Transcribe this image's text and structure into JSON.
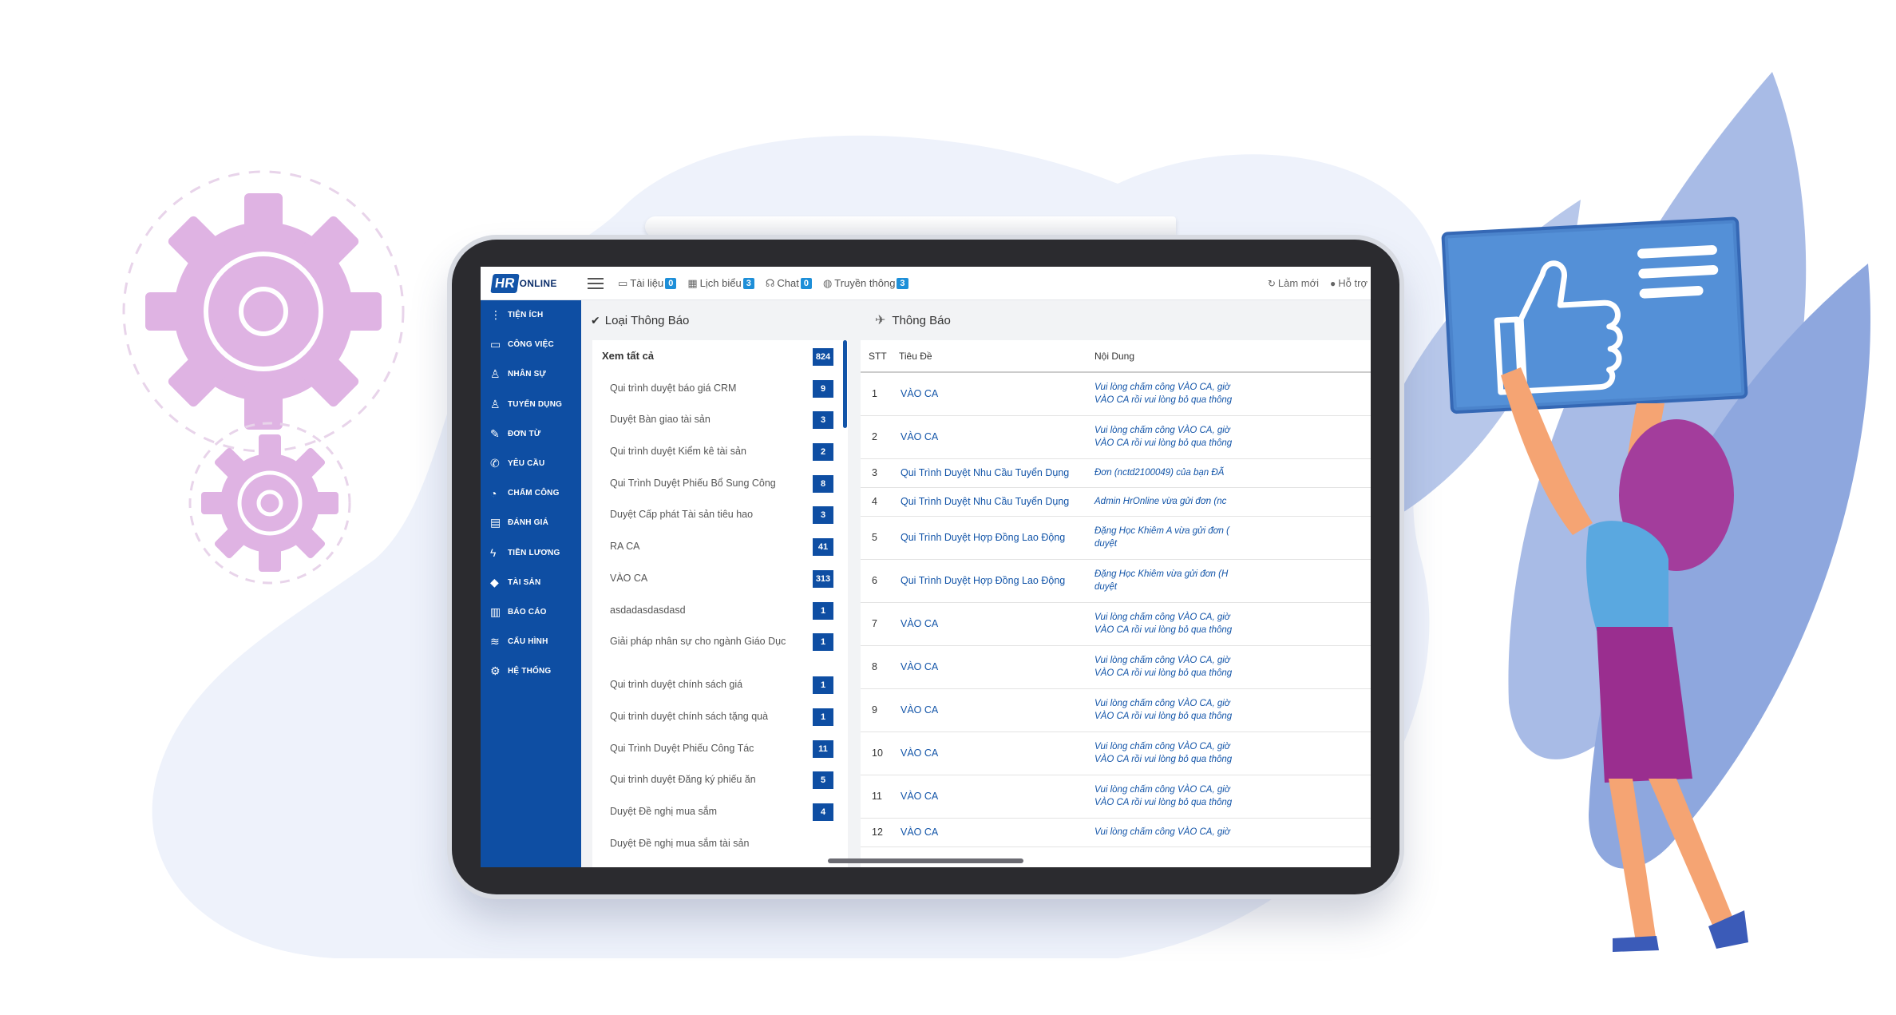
{
  "colors": {
    "sidebar": "#0e4ea3",
    "badge": "#1e8fd8",
    "link": "#1254a8",
    "gear": "#d7a8dd",
    "card": "#4b84cf",
    "leaf": "#8ea7de"
  },
  "logo": {
    "hr": "HR",
    "online": "ONLINE"
  },
  "topnav": [
    {
      "icon": "folder-icon",
      "label": "Tài liệu",
      "badge": "0"
    },
    {
      "icon": "calendar-icon",
      "label": "Lịch biểu",
      "badge": "3"
    },
    {
      "icon": "chat-icon",
      "label": "Chat",
      "badge": "0"
    },
    {
      "icon": "globe-icon",
      "label": "Truyền thông",
      "badge": "3"
    }
  ],
  "topright": [
    {
      "icon": "refresh-icon",
      "label": "Làm mới"
    },
    {
      "icon": "help-icon",
      "label": "Hỗ trợ"
    }
  ],
  "sidebar": [
    {
      "icon": "menu-dots-icon",
      "label": "Tiện ích"
    },
    {
      "icon": "inbox-icon",
      "label": "Công việc"
    },
    {
      "icon": "user-icon",
      "label": "Nhân sự"
    },
    {
      "icon": "user-add-icon",
      "label": "Tuyển dụng"
    },
    {
      "icon": "edit-icon",
      "label": "Đơn từ"
    },
    {
      "icon": "phone-icon",
      "label": "Yêu cầu"
    },
    {
      "icon": "clock-icon",
      "label": "Chấm công"
    },
    {
      "icon": "book-icon",
      "label": "Đánh giá"
    },
    {
      "icon": "bolt-icon",
      "label": "Tiền lương"
    },
    {
      "icon": "diamond-icon",
      "label": "Tài sản"
    },
    {
      "icon": "bar-chart-icon",
      "label": "Báo cáo"
    },
    {
      "icon": "layers-icon",
      "label": "Cấu hình"
    },
    {
      "icon": "gear-icon",
      "label": "Hệ thống"
    }
  ],
  "left_panel": {
    "title": "Loại Thông Báo",
    "view_all": {
      "label": "Xem tất cả",
      "count": "824"
    },
    "categories": [
      {
        "label": "Qui trình duyệt báo giá CRM",
        "count": "9"
      },
      {
        "label": "Duyệt Bàn giao tài sản",
        "count": "3"
      },
      {
        "label": "Qui trình duyệt Kiểm kê tài sản",
        "count": "2"
      },
      {
        "label": "Qui Trình Duyệt Phiếu Bổ Sung Công",
        "count": "8"
      },
      {
        "label": "Duyệt Cấp phát Tài sản tiêu hao",
        "count": "3"
      },
      {
        "label": "RA CA",
        "count": "41"
      },
      {
        "label": "VÀO CA",
        "count": "313"
      },
      {
        "label": "asdadasdasdasd",
        "count": "1"
      },
      {
        "label": "Giải pháp nhân sự cho ngành Giáo Dục",
        "count": "1"
      },
      {
        "label": "Qui trình duyệt chính sách giá",
        "count": "1"
      },
      {
        "label": "Qui trình duyệt chính sách tặng quà",
        "count": "1"
      },
      {
        "label": "Qui Trình Duyệt Phiếu Công Tác",
        "count": "11"
      },
      {
        "label": "Qui trình duyệt Đăng ký phiếu ăn",
        "count": "5"
      },
      {
        "label": "Duyệt Đề nghị mua sắm",
        "count": "4"
      },
      {
        "label": "Duyệt Đề nghị mua sắm tài sản",
        "count": ""
      }
    ]
  },
  "right_panel": {
    "title": "Thông Báo",
    "headers": {
      "stt": "STT",
      "title": "Tiêu Đề",
      "content": "Nội Dung"
    },
    "rows": [
      {
        "stt": "1",
        "title": "VÀO CA",
        "content1": "Vui lòng chấm công VÀO CA, giờ",
        "content2": "VÀO CA rồi vui lòng bỏ qua thông"
      },
      {
        "stt": "2",
        "title": "VÀO CA",
        "content1": "Vui lòng chấm công VÀO CA, giờ",
        "content2": "VÀO CA rồi vui lòng bỏ qua thông"
      },
      {
        "stt": "3",
        "title": "Qui Trình Duyệt Nhu Cầu Tuyển Dụng",
        "content1": "Đơn (nctd2100049) của bạn ĐÃ",
        "content2": ""
      },
      {
        "stt": "4",
        "title": "Qui Trình Duyệt Nhu Cầu Tuyển Dụng",
        "content1": "Admin HrOnline vừa gửi đơn (nc",
        "content2": ""
      },
      {
        "stt": "5",
        "title": "Qui Trình Duyệt Hợp Đồng Lao Động",
        "content1": "Đặng Học Khiêm A vừa gửi đơn (",
        "content2": "duyệt"
      },
      {
        "stt": "6",
        "title": "Qui Trình Duyệt Hợp Đồng Lao Động",
        "content1": "Đặng Học Khiêm vừa gửi đơn (H",
        "content2": "duyệt"
      },
      {
        "stt": "7",
        "title": "VÀO CA",
        "content1": "Vui lòng chấm công VÀO CA, giờ",
        "content2": "VÀO CA rồi vui lòng bỏ qua thông"
      },
      {
        "stt": "8",
        "title": "VÀO CA",
        "content1": "Vui lòng chấm công VÀO CA, giờ",
        "content2": "VÀO CA rồi vui lòng bỏ qua thông"
      },
      {
        "stt": "9",
        "title": "VÀO CA",
        "content1": "Vui lòng chấm công VÀO CA, giờ",
        "content2": "VÀO CA rồi vui lòng bỏ qua thông"
      },
      {
        "stt": "10",
        "title": "VÀO CA",
        "content1": "Vui lòng chấm công VÀO CA, giờ",
        "content2": "VÀO CA rồi vui lòng bỏ qua thông"
      },
      {
        "stt": "11",
        "title": "VÀO CA",
        "content1": "Vui lòng chấm công VÀO CA, giờ",
        "content2": "VÀO CA rồi vui lòng bỏ qua thông"
      },
      {
        "stt": "12",
        "title": "VÀO CA",
        "content1": "Vui lòng chấm công VÀO CA, giờ",
        "content2": ""
      }
    ]
  }
}
